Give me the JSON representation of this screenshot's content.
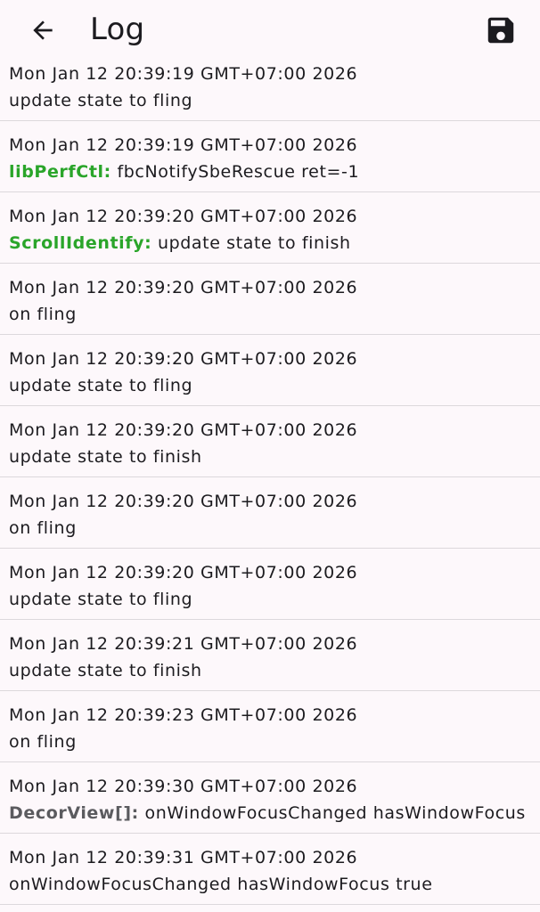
{
  "header": {
    "title": "Log",
    "back_icon": "arrow-left-icon",
    "save_icon": "save-floppy-icon"
  },
  "colors": {
    "background": "#fdf8fb",
    "tag_green": "#2aa52a",
    "tag_gray": "#5b5b5f",
    "divider": "#dcd8dc"
  },
  "log": {
    "items": [
      {
        "timestamp": "Mon Jan 12 20:39:19 GMT+07:00 2026",
        "tag": "",
        "message": "update state to fling"
      },
      {
        "timestamp": "Mon Jan 12 20:39:19 GMT+07:00 2026",
        "tag": "libPerfCtl:",
        "message": " fbcNotifySbeRescue ret=-1"
      },
      {
        "timestamp": "Mon Jan 12 20:39:20 GMT+07:00 2026",
        "tag": "ScrollIdentify:",
        "message": " update state to finish"
      },
      {
        "timestamp": "Mon Jan 12 20:39:20 GMT+07:00 2026",
        "tag": "",
        "message": "on fling"
      },
      {
        "timestamp": "Mon Jan 12 20:39:20 GMT+07:00 2026",
        "tag": "",
        "message": "update state to fling"
      },
      {
        "timestamp": "Mon Jan 12 20:39:20 GMT+07:00 2026",
        "tag": "",
        "message": "update state to finish"
      },
      {
        "timestamp": "Mon Jan 12 20:39:20 GMT+07:00 2026",
        "tag": "",
        "message": "on fling"
      },
      {
        "timestamp": "Mon Jan 12 20:39:20 GMT+07:00 2026",
        "tag": "",
        "message": "update state to fling"
      },
      {
        "timestamp": "Mon Jan 12 20:39:21 GMT+07:00 2026",
        "tag": "",
        "message": "update state to finish"
      },
      {
        "timestamp": "Mon Jan 12 20:39:23 GMT+07:00 2026",
        "tag": "",
        "message": "on fling"
      },
      {
        "timestamp": "Mon Jan 12 20:39:30 GMT+07:00 2026",
        "tag": "DecorView[]:",
        "message": " onWindowFocusChanged hasWindowFocus"
      },
      {
        "timestamp": "Mon Jan 12 20:39:31 GMT+07:00 2026",
        "tag": "",
        "message": "onWindowFocusChanged hasWindowFocus true"
      }
    ]
  }
}
